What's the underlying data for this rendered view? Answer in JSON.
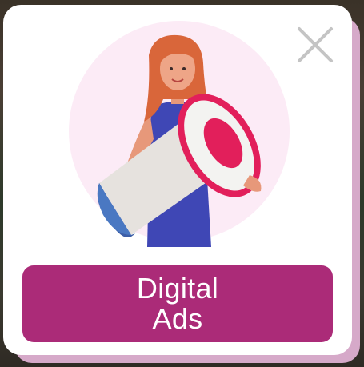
{
  "popup": {
    "close_icon": "close-icon",
    "illustration_icon": "woman-with-megaphone-illustration",
    "cta_line1": "Digital",
    "cta_line2": "Ads"
  },
  "colors": {
    "accent": "#ab2b78",
    "card_shadow": "#d6a9c9",
    "circle_bg": "#fcebf6",
    "megaphone_rim": "#e21f5b"
  }
}
